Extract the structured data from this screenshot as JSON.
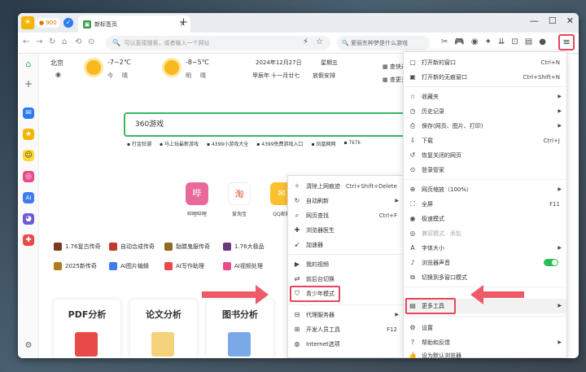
{
  "tabbar": {
    "coins": "900",
    "tab_title": "新标签页",
    "new_tab": "+",
    "controls": [
      "—",
      "☐",
      "✕"
    ]
  },
  "address": {
    "placeholder": "可以直接搜索，或者输入一个网址",
    "search_placeholder": "爱丽东种梦是什么游戏"
  },
  "weather": {
    "city": "北京",
    "today_temp": "-7~2℃",
    "today_label": "今",
    "today_cond": "晴",
    "tomorrow_temp": "-8~5℃",
    "tomorrow_label": "明",
    "tomorrow_cond": "晴",
    "date": "2024年12月27日",
    "weekday": "星期五",
    "lunar": "甲辰年 十一月廿七",
    "holiday": "放假安排",
    "link1": "查快递",
    "link2": "查更多"
  },
  "search": {
    "value": "360游戏",
    "hot_label": "热"
  },
  "hot_items": [
    "打金狂潮",
    "马上玩最新游戏",
    "4399小游戏大全",
    "4399免费游戏入口",
    "凤凰网网",
    "7k7k"
  ],
  "apps": [
    {
      "label": "哔哩哔哩",
      "glyph": "哔"
    },
    {
      "label": "爱淘宝",
      "glyph": "淘"
    },
    {
      "label": "QQ邮箱",
      "glyph": "✉"
    }
  ],
  "game_list_row1": [
    "1.76复古传奇",
    "自动合成传奇",
    "骷髅鬼服传奇",
    "1.76大极品"
  ],
  "game_list_row2": [
    "2025新传奇",
    "AI图片编辑",
    "AI写作助理",
    "AI视频处理"
  ],
  "cards": [
    "PDF分析",
    "论文分析",
    "图书分析"
  ],
  "main_menu": {
    "new_window": "打开新的窗口",
    "new_window_sc": "Ctrl+N",
    "incognito": "打开新的无痕窗口",
    "incognito_sc": "Ctrl+Shift+N",
    "favorites": "收藏夹",
    "history": "历史记录",
    "save": "保存(网页、图片、打印)",
    "download": "下载",
    "download_sc": "Ctrl+J",
    "restore": "恢复关闭的网页",
    "login": "登录管家",
    "zoom": "网页缩放（100%）",
    "fullscreen": "全屏",
    "fullscreen_sc": "F11",
    "fastmode": "极速模式",
    "compat": "兼容模式  ·  添加",
    "fontsize": "字体大小",
    "sound": "浏览器声音",
    "switch_window": "切换到多窗口模式",
    "more_tools": "更多工具",
    "settings": "设置",
    "help": "帮助和反馈",
    "set_default": "设为默认浏览器"
  },
  "sub_menu": {
    "clear": "清除上网痕迹",
    "clear_sc": "Ctrl+Shift+Delete",
    "autorefresh": "自动刷新",
    "find": "网页查找",
    "find_sc": "Ctrl+F",
    "doctor": "浏览器医生",
    "accelerator": "加速器",
    "video": "我的视频",
    "switch_bg": "前后台切换",
    "teen": "青少年模式",
    "proxy": "代理服务器",
    "devtools": "开发人员工具",
    "devtools_sc": "F12",
    "internet": "Internet选项"
  },
  "colors": {
    "accent_green": "#3fb560",
    "highlight_red": "#e8475a",
    "arrow": "#ef5a6a"
  }
}
